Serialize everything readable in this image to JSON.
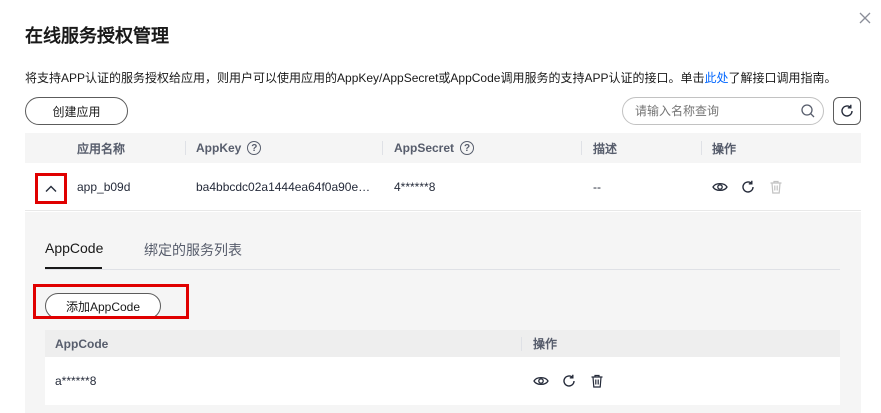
{
  "dialog": {
    "title": "在线服务授权管理",
    "close_icon": "close-icon",
    "description": {
      "before": "将支持APP认证的服务授权给应用，则用户可以使用应用的AppKey/AppSecret或AppCode调用服务的支持APP认证的接口。单击",
      "link": "此处",
      "after": "了解接口调用指南。"
    }
  },
  "toolbar": {
    "create_label": "创建应用",
    "search_placeholder": "请输入名称查询",
    "search_icon": "search-icon",
    "refresh_icon": "refresh-icon"
  },
  "table": {
    "headers": {
      "name": "应用名称",
      "appkey": "AppKey",
      "appsecret": "AppSecret",
      "desc": "描述",
      "ops": "操作"
    },
    "help_icon": "help-icon",
    "row": {
      "name": "app_b09d",
      "appkey": "ba4bbcdc02a1444ea64f0a90e…",
      "appsecret": "4******8",
      "desc": "--"
    }
  },
  "detail": {
    "tabs": [
      "AppCode",
      "绑定的服务列表"
    ],
    "active_tab": "AppCode",
    "add_label": "添加AppCode",
    "headers": {
      "appcode": "AppCode",
      "ops": "操作"
    },
    "row": {
      "appcode": "a******8"
    }
  },
  "colors": {
    "highlight": "#e00000",
    "link": "#0066ff"
  }
}
